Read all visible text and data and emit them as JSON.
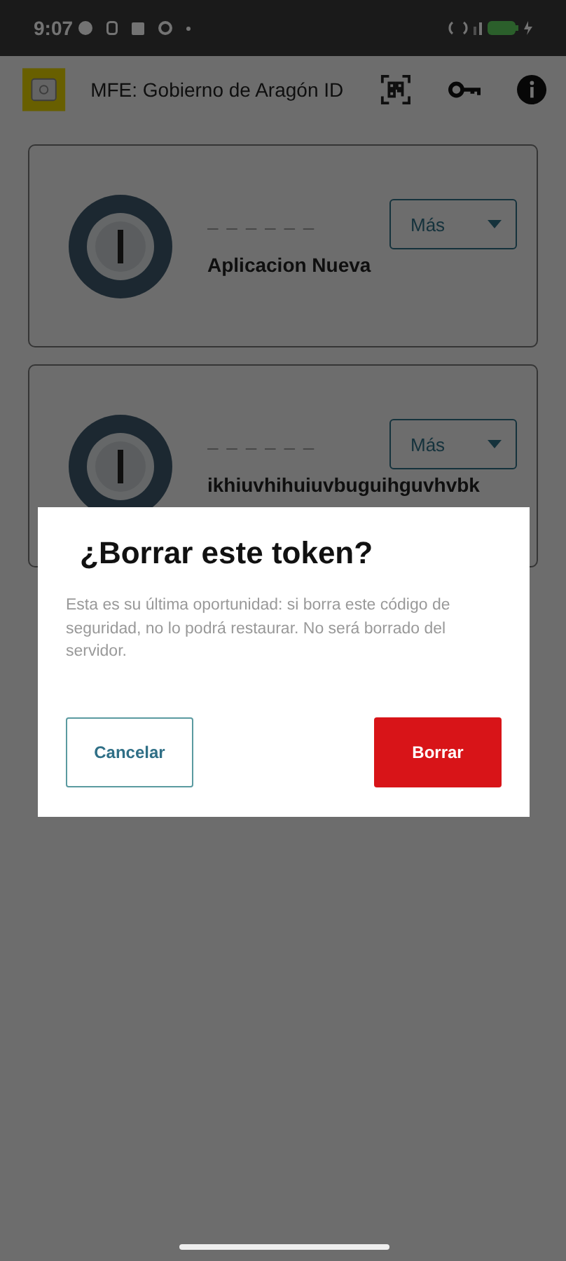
{
  "status_bar": {
    "time": "9:07"
  },
  "app_bar": {
    "title": "MFE: Gobierno de Aragón ID"
  },
  "tokens": [
    {
      "code": "– – – – – –",
      "name": "Aplicacion Nueva",
      "menu": "Más"
    },
    {
      "code": "– – – – – –",
      "name": "ikhiuvhihuiuvbuguihguvhvbk",
      "menu": "Más"
    }
  ],
  "dialog": {
    "title": "¿Borrar este token?",
    "message": "Esta es su última oportunidad: si borra este código de seguridad, no lo podrá restaurar. No será borrado del servidor.",
    "buttons": [
      {
        "label": "Cancelar",
        "kind": "outlined"
      },
      {
        "label": "Borrar",
        "kind": "filled"
      }
    ]
  }
}
